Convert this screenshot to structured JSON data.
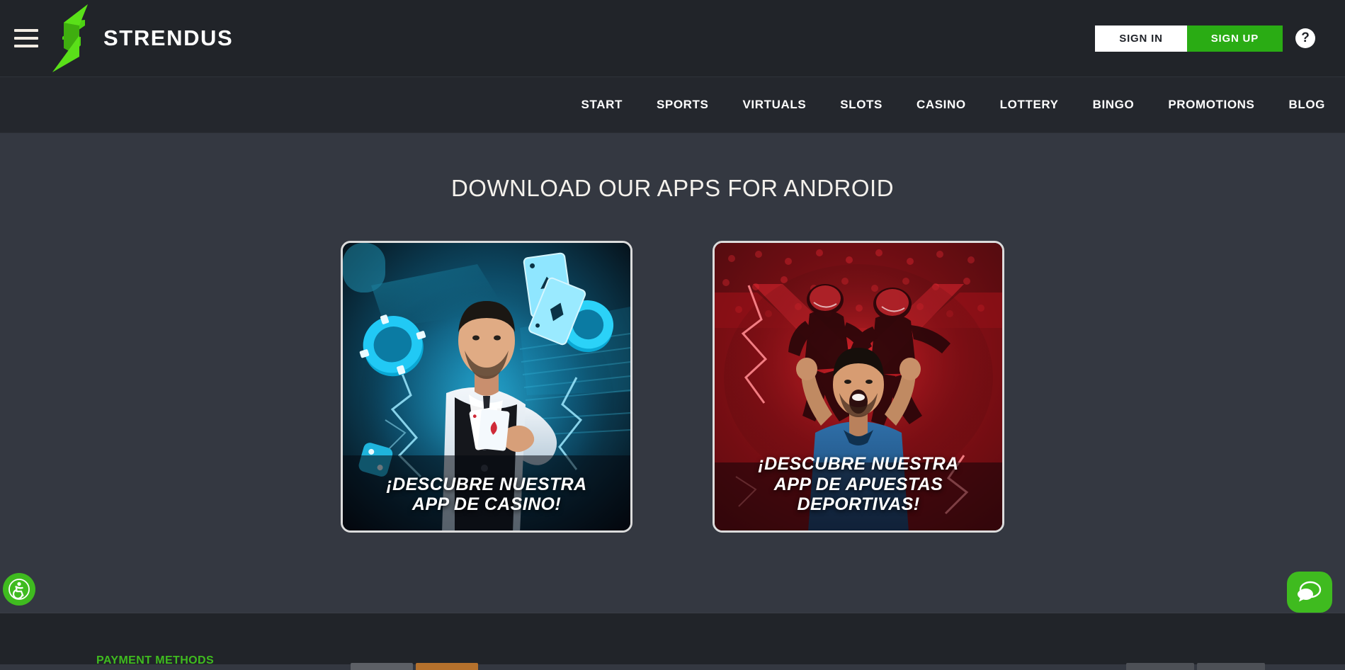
{
  "header": {
    "menu_icon": "hamburger-menu-icon",
    "brand": "STRENDUS",
    "logo_icon": "strendus-bolt-logo",
    "sign_in_label": "SIGN IN",
    "sign_up_label": "SIGN UP",
    "help_label": "?",
    "colors": {
      "background": "#212429",
      "brand_green": "#3fbb1f",
      "signup_green": "#2aac14",
      "signin_bg": "#ffffff"
    }
  },
  "nav": {
    "items": [
      {
        "label": "START"
      },
      {
        "label": "SPORTS"
      },
      {
        "label": "VIRTUALS"
      },
      {
        "label": "SLOTS"
      },
      {
        "label": "CASINO"
      },
      {
        "label": "LOTTERY"
      },
      {
        "label": "BINGO"
      },
      {
        "label": "PROMOTIONS"
      },
      {
        "label": "BLOG"
      }
    ]
  },
  "main": {
    "title": "DOWNLOAD OUR APPS FOR ANDROID",
    "background": "#343841",
    "cards": [
      {
        "id": "casino-app-card",
        "caption_line1": "¡DESCUBRE NUESTRA",
        "caption_line2": "APP DE CASINO!",
        "theme_color": "#18c7f0",
        "art": "casino-dealer-with-cards-chips-dice"
      },
      {
        "id": "sports-app-card",
        "caption_line1": "¡DESCUBRE NUESTRA",
        "caption_line2": "APP DE APUESTAS DEPORTIVAS!",
        "theme_color": "#d81f28",
        "art": "cheering-football-fan-with-players"
      }
    ]
  },
  "footer": {
    "payment_heading": "PAYMENT METHODS",
    "heading_color": "#3fbb1f",
    "background": "#212429"
  },
  "widgets": {
    "accessibility": {
      "icon": "wheelchair-accessibility-icon",
      "color": "#3fbb1f"
    },
    "chat": {
      "icon": "chat-bubbles-icon",
      "color": "#3fbb1f"
    }
  }
}
